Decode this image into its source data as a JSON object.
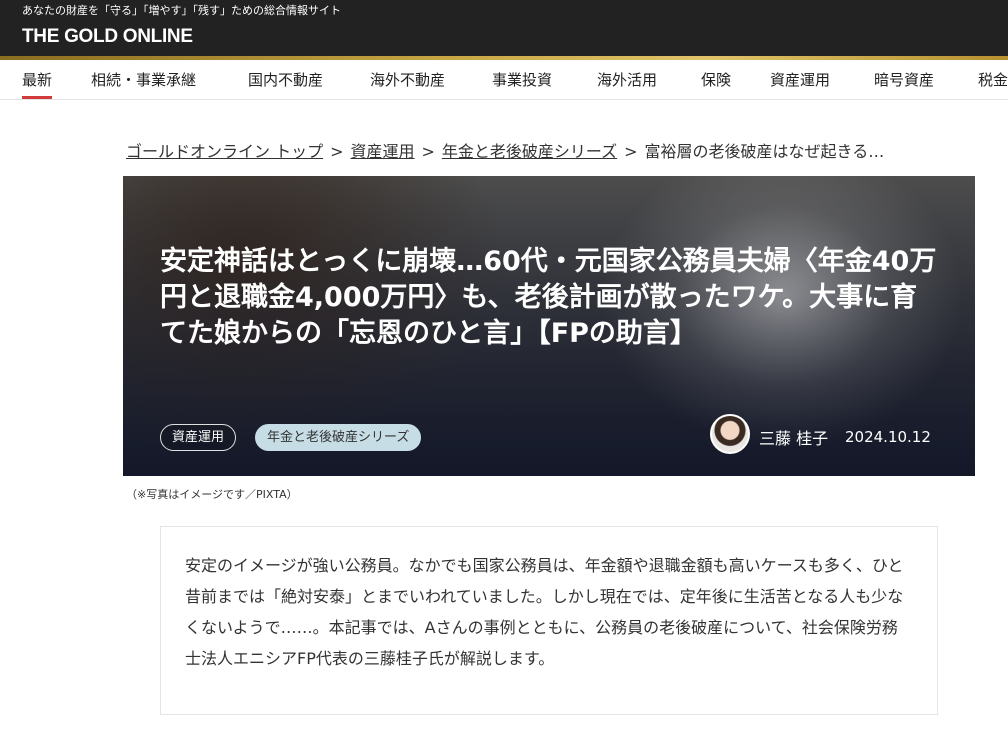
{
  "header": {
    "tagline": "あなたの財産を「守る」「増やす」「残す」ための総合情報サイト",
    "logo": "THE GOLD ONLINE"
  },
  "nav": {
    "items": [
      {
        "label": "最新",
        "active": true
      },
      {
        "label": "相続・事業承継"
      },
      {
        "label": "国内不動産"
      },
      {
        "label": "海外不動産"
      },
      {
        "label": "事業投資"
      },
      {
        "label": "海外活用"
      },
      {
        "label": "保険"
      },
      {
        "label": "資産運用"
      },
      {
        "label": "暗号資産"
      },
      {
        "label": "税金"
      }
    ]
  },
  "breadcrumb": {
    "items": [
      "ゴールドオンライン トップ",
      "資産運用",
      "年金と老後破産シリーズ"
    ],
    "separator": ">",
    "current": "富裕層の老後破産はなぜ起きる…"
  },
  "hero": {
    "title": "安定神話はとっくに崩壊…60代・元国家公務員夫婦〈年金40万円と退職金4,000万円〉も、老後計画が散ったワケ。大事に育てた娘からの「忘恩のひと言」【FPの助言】",
    "tags": [
      "資産運用",
      "年金と老後破産シリーズ"
    ],
    "author": "三藤 桂子",
    "date": "2024.10.12"
  },
  "caption": "（※写真はイメージです／PIXTA）",
  "lead": "安定のイメージが強い公務員。なかでも国家公務員は、年金額や退職金額も高いケースも多く、ひと昔前までは「絶対安泰」とまでいわれていました。しかし現在では、定年後に生活苦となる人も少なくないようで……。本記事では、Aさんの事例とともに、公務員の老後破産について、社会保険労務士法人エニシアFP代表の三藤桂子氏が解説します。",
  "colors": {
    "header_bg": "#222222",
    "gold": "#c9a744",
    "nav_active": "#d23b3b",
    "tag_filled": "#c7dde6"
  }
}
